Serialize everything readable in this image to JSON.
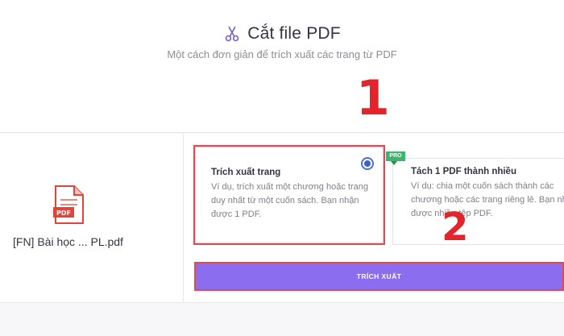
{
  "header": {
    "title": "Cắt file PDF",
    "subtitle": "Một cách đơn giản để trích xuất các trang từ PDF",
    "title_icon": "scissors-icon"
  },
  "annotations": {
    "step_1": "1",
    "step_2": "2"
  },
  "file": {
    "icon": "pdf-file-icon",
    "icon_label": "PDF",
    "name": "[FN] Bài học ... PL.pdf"
  },
  "options": [
    {
      "title": "Trích xuất trang",
      "description": "Ví dụ, trích xuất một chương hoặc trang duy nhất từ một cuốn sách. Bạn nhận được 1 PDF.",
      "selected": true
    },
    {
      "title": "Tách 1 PDF thành nhiều",
      "description_lines": [
        "Ví dụ: chia một cuốn sách thành các",
        "chương hoặc các trang riêng lẻ. Bạn nhậ",
        "được nhiều tệp PDF."
      ],
      "badge": "PRO",
      "selected": false
    }
  ],
  "action": {
    "label": "TRÍCH XUẤT"
  },
  "colors": {
    "accent": "#8b6df0",
    "highlight": "#e14a55",
    "annotation": "#e4242b",
    "pro": "#3db56c",
    "radio": "#3a5fd0",
    "pdf": "#e0453a"
  }
}
